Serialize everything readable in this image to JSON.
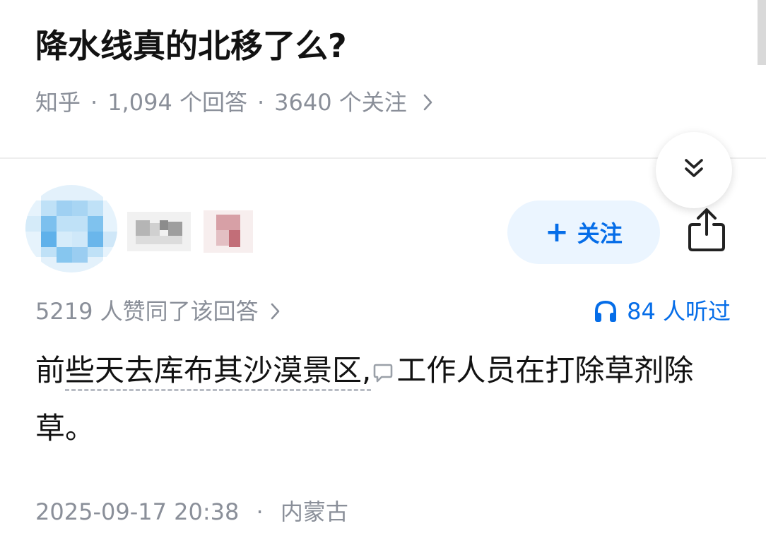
{
  "question": {
    "title": "降水线真的北移了么?",
    "source": "知乎",
    "answers_count": "1,094 个回答",
    "followers_count": "3640 个关注",
    "separator": "·"
  },
  "author": {
    "follow_label": "关注",
    "follow_plus": "+"
  },
  "answer": {
    "upvote_text": "5219 人赞同了该回答",
    "listen_text": "84 人听过",
    "content_part1": "前",
    "content_linked": "些天去库布其沙漠景区,",
    "content_part2": "工作人员在打除草剂除草。",
    "date_time": "2025-09-17 20:38",
    "location": "内蒙古",
    "separator": "·"
  },
  "colors": {
    "accent_blue": "#056de8",
    "follow_bg": "#ebf5ff",
    "meta_gray": "#8a8f99",
    "text_dark": "#121212"
  },
  "icons": {
    "collapse": "double-chevron-down-icon",
    "share": "share-icon",
    "listen": "headphone-icon",
    "chevron": "chevron-right-icon",
    "comment": "comment-bubble-icon"
  }
}
